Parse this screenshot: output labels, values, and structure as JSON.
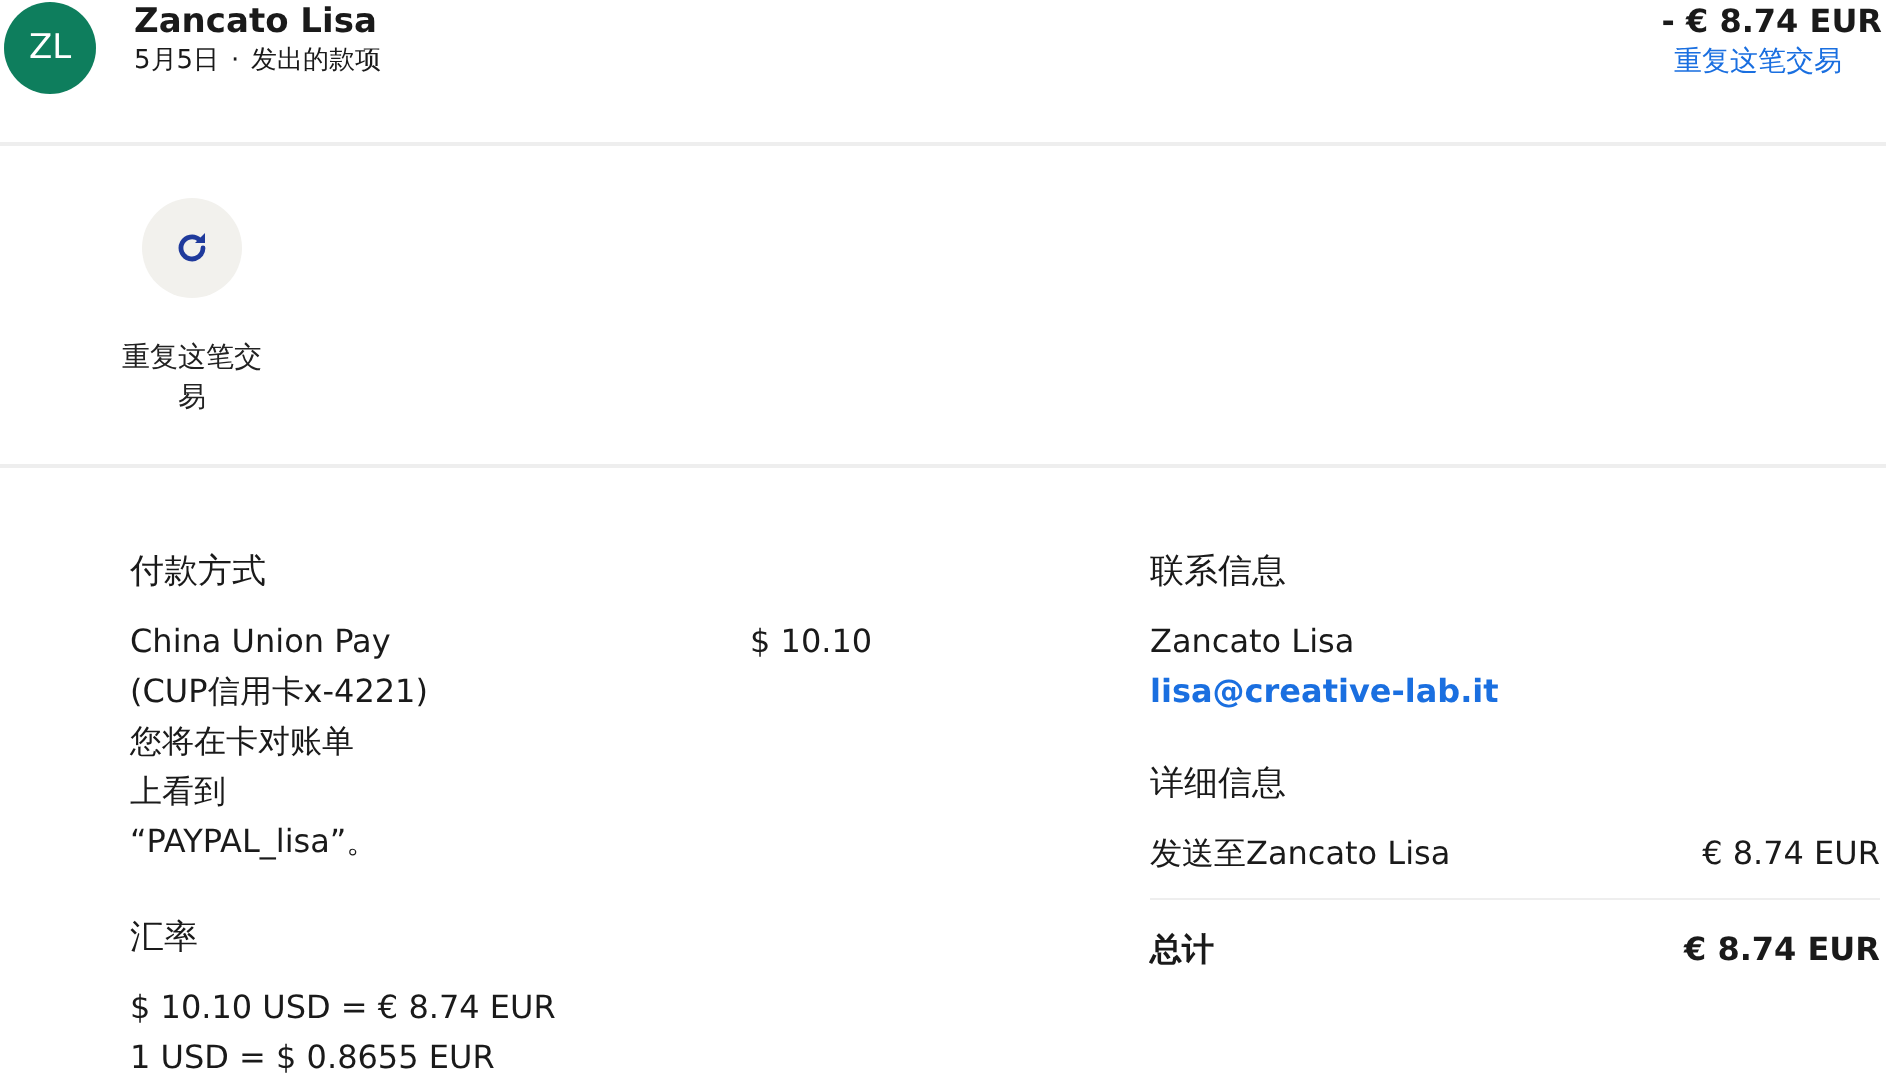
{
  "header": {
    "avatar": "ZL",
    "name": "Zancato Lisa",
    "date": "5月5日",
    "separator": "·",
    "type": "发出的款项",
    "amount": "- € 8.74 EUR",
    "repeat_link": "重复这笔交易"
  },
  "actions": [
    {
      "label": "重复这笔交易"
    }
  ],
  "payment": {
    "title": "付款方式",
    "method": "China Union Pay",
    "card": "(CUP信用卡x-4221)",
    "note_lines": [
      "您将在卡对账单",
      "上看到",
      "“PAYPAL_lisa”。"
    ],
    "amount": "$ 10.10"
  },
  "exchange": {
    "title": "汇率",
    "lines": [
      "$ 10.10 USD = € 8.74 EUR",
      "1 USD = $ 0.8655 EUR"
    ]
  },
  "contact": {
    "title": "联系信息",
    "name": "Zancato Lisa",
    "email": "lisa@creative-lab.it"
  },
  "details": {
    "title": "详细信息",
    "rows": [
      {
        "label": "发送至Zancato Lisa",
        "value": "€ 8.74 EUR",
        "kind": "item"
      },
      {
        "label": "总计",
        "value": "€ 8.74 EUR",
        "kind": "total"
      }
    ]
  }
}
